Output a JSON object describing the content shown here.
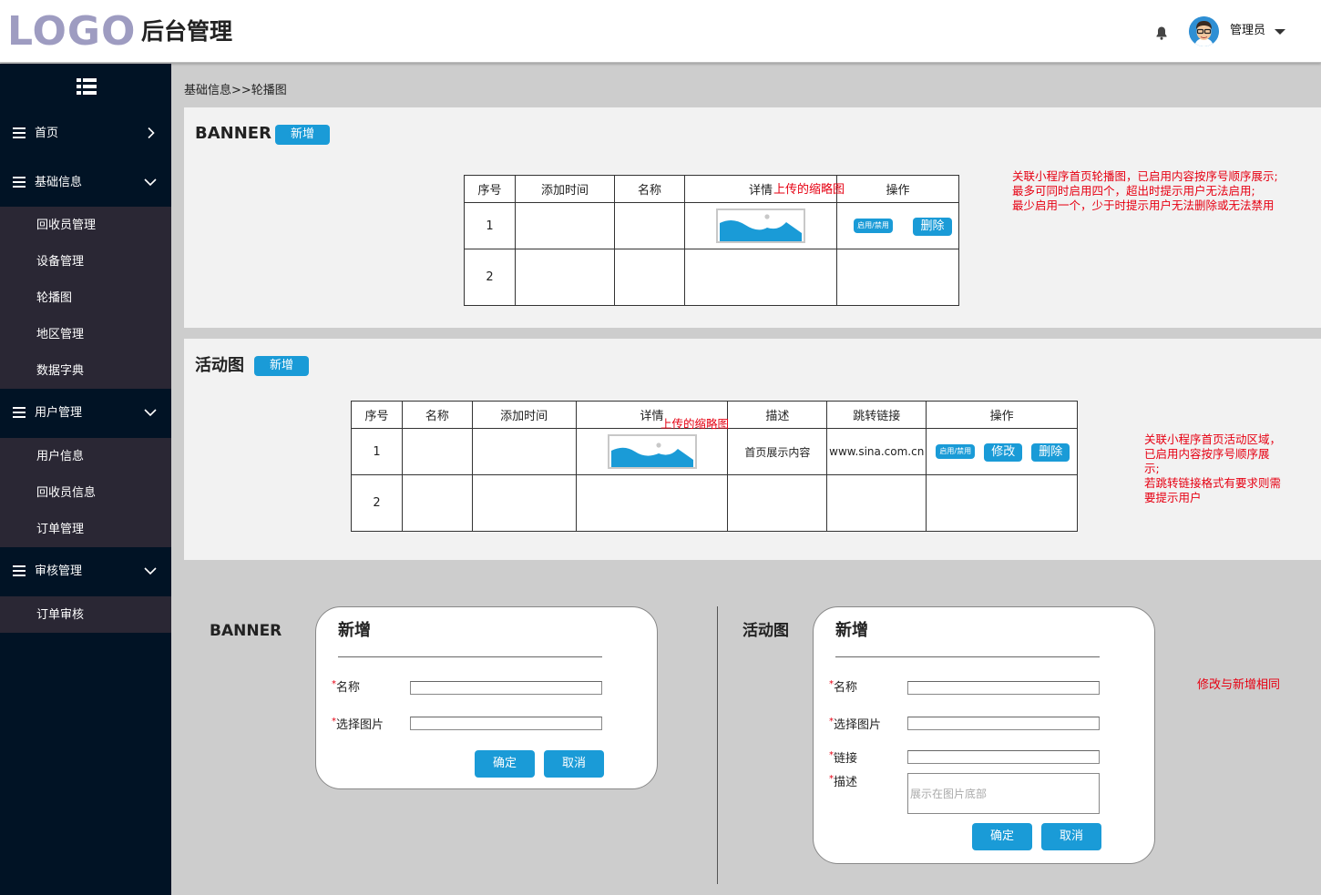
{
  "header": {
    "logo": "LOGO",
    "title": "后台管理",
    "user": "管理员"
  },
  "sidebar": {
    "groups": [
      {
        "label": "首页"
      },
      {
        "label": "基础信息",
        "items": [
          "回收员管理",
          "设备管理",
          "轮播图",
          "地区管理",
          "数据字典"
        ]
      },
      {
        "label": "用户管理",
        "items": [
          "用户信息",
          "回收员信息",
          "订单管理"
        ]
      },
      {
        "label": "审核管理",
        "items": [
          "订单审核"
        ]
      }
    ]
  },
  "breadcrumb": "基础信息>>轮播图",
  "banner": {
    "title": "BANNER",
    "add_label": "新增",
    "headers": [
      "序号",
      "添加时间",
      "名称",
      "详情",
      "操作"
    ],
    "rows": [
      {
        "index": "1",
        "toggle": "启用/禁用",
        "delete": "删除"
      },
      {
        "index": "2"
      }
    ],
    "thumb_note": "上传的缩略图",
    "note": "关联小程序首页轮播图，已启用内容按序号顺序展示;\n最多可同时启用四个，超出时提示用户无法启用;\n最少启用一个，少于时提示用户无法删除或无法禁用"
  },
  "activity": {
    "title": "活动图",
    "add_label": "新增",
    "headers": [
      "序号",
      "名称",
      "添加时间",
      "详情",
      "描述",
      "跳转链接",
      "操作"
    ],
    "rows": [
      {
        "index": "1",
        "desc": "首页展示内容",
        "link": "www.sina.com.cn",
        "toggle": "启用/禁用",
        "edit": "修改",
        "delete": "删除"
      },
      {
        "index": "2"
      }
    ],
    "thumb_note": "上传的缩略图",
    "note": "关联小程序首页活动区域，\n已启用内容按序号顺序展\n示;\n若跳转链接格式有要求则需\n要提示用户"
  },
  "forms": {
    "banner": {
      "section": "BANNER",
      "title": "新增",
      "name_label": "名称",
      "image_label": "选择图片",
      "ok": "确定",
      "cancel": "取消"
    },
    "activity": {
      "section": "活动图",
      "title": "新增",
      "name_label": "名称",
      "image_label": "选择图片",
      "link_label": "链接",
      "desc_label": "描述",
      "desc_placeholder": "展示在图片底部",
      "ok": "确定",
      "cancel": "取消"
    },
    "required_mark": "*",
    "note": "修改与新增相同"
  },
  "colors": {
    "accent": "#1a9bd7",
    "sidebar_bg": "#011325",
    "submenu_bg": "#2a2734",
    "note_red": "#e60012",
    "logo": "#9e9cc1"
  }
}
